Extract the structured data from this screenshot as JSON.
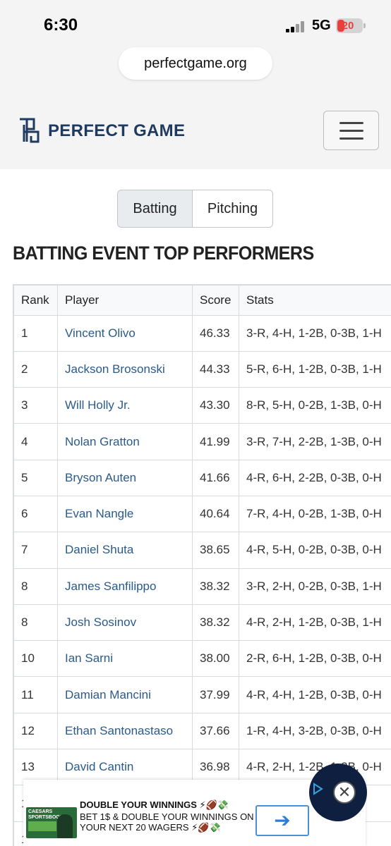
{
  "status": {
    "time": "6:30",
    "network": "5G",
    "battery": "20"
  },
  "browser": {
    "url": "perfectgame.org"
  },
  "header": {
    "logo_text": "PERFECT GAME"
  },
  "tabs": {
    "batting": "Batting",
    "pitching": "Pitching",
    "active": "Batting"
  },
  "section_title": "BATTING EVENT TOP PERFORMERS",
  "table": {
    "headers": [
      "Rank",
      "Player",
      "Score",
      "Stats"
    ],
    "rows": [
      [
        "1",
        "Vincent Olivo",
        "46.33",
        "3-R, 4-H, 1-2B, 0-3B, 1-H"
      ],
      [
        "2",
        "Jackson Brosonski",
        "44.33",
        "5-R, 6-H, 1-2B, 0-3B, 1-H"
      ],
      [
        "3",
        "Will Holly Jr.",
        "43.30",
        "8-R, 5-H, 0-2B, 1-3B, 0-H"
      ],
      [
        "4",
        "Nolan Gratton",
        "41.99",
        "3-R, 7-H, 2-2B, 1-3B, 0-H"
      ],
      [
        "5",
        "Bryson Auten",
        "41.66",
        "4-R, 6-H, 2-2B, 0-3B, 0-H"
      ],
      [
        "6",
        "Evan Nangle",
        "40.64",
        "7-R, 4-H, 0-2B, 1-3B, 0-H"
      ],
      [
        "7",
        "Daniel Shuta",
        "38.65",
        "4-R, 5-H, 0-2B, 0-3B, 0-H"
      ],
      [
        "8",
        "James Sanfilippo",
        "38.32",
        "3-R, 2-H, 0-2B, 0-3B, 1-H"
      ],
      [
        "8",
        "Josh Sosinov",
        "38.32",
        "4-R, 2-H, 1-2B, 0-3B, 1-H"
      ],
      [
        "10",
        "Ian Sarni",
        "38.00",
        "2-R, 6-H, 1-2B, 0-3B, 0-H"
      ],
      [
        "11",
        "Damian Mancini",
        "37.99",
        "4-R, 4-H, 1-2B, 0-3B, 0-H"
      ],
      [
        "12",
        "Ethan Santonastaso",
        "37.66",
        "1-R, 4-H, 3-2B, 0-3B, 0-H"
      ],
      [
        "13",
        "David Cantin",
        "36.98",
        "4-R, 2-H, 1-2B, 1-3B, 0-H"
      ],
      [
        "1",
        "",
        "",
        "0-H"
      ],
      [
        "1",
        "",
        "",
        "0-H"
      ]
    ]
  },
  "ad": {
    "brand": "CAESARS SPORTSBOOK",
    "headline": "DOUBLE YOUR WINNINGS ⚡🏈💸",
    "body": "BET 1$ & DOUBLE YOUR WINNINGS ON YOUR NEXT 20 WAGERS ⚡🏈💸",
    "arrow": "➔",
    "close": "✕"
  },
  "colors": {
    "brand": "#1f3a5f",
    "link": "#2a5a8c",
    "battery_low": "#e8403a",
    "ad_button": "#2d7ddb"
  }
}
